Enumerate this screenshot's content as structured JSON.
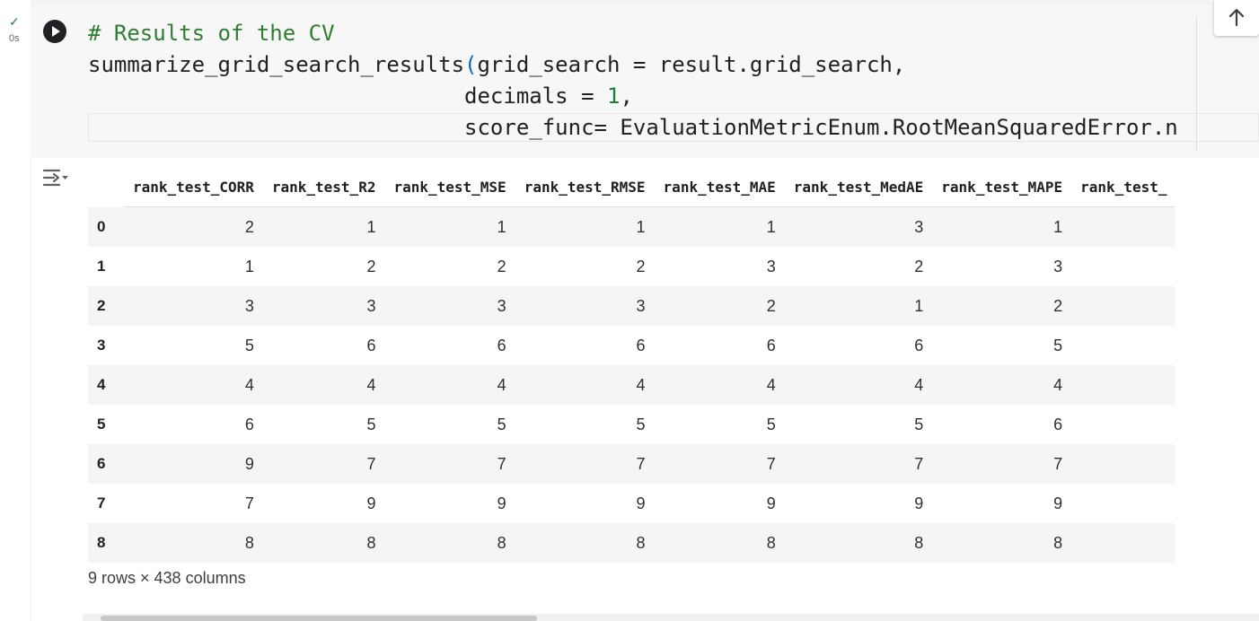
{
  "cell": {
    "status_check": "✓",
    "exec_time": "0s",
    "code": {
      "comment": "# Results of the CV",
      "line2_fn": "summarize_grid_search_results",
      "line2_paren": "(",
      "line2_rest": "grid_search = result.grid_search,",
      "line3_indent": "                             ",
      "line3_pre": "decimals = ",
      "line3_num": "1",
      "line3_post": ",",
      "line4_indent": "                             ",
      "line4": "score_func= EvaluationMetricEnum.RootMeanSquaredError.n"
    }
  },
  "output": {
    "columns": [
      "rank_test_CORR",
      "rank_test_R2",
      "rank_test_MSE",
      "rank_test_RMSE",
      "rank_test_MAE",
      "rank_test_MedAE",
      "rank_test_MAPE",
      "rank_test_"
    ],
    "rows": [
      {
        "index": "0",
        "values": [
          "2",
          "1",
          "1",
          "1",
          "1",
          "3",
          "1"
        ]
      },
      {
        "index": "1",
        "values": [
          "1",
          "2",
          "2",
          "2",
          "3",
          "2",
          "3"
        ]
      },
      {
        "index": "2",
        "values": [
          "3",
          "3",
          "3",
          "3",
          "2",
          "1",
          "2"
        ]
      },
      {
        "index": "3",
        "values": [
          "5",
          "6",
          "6",
          "6",
          "6",
          "6",
          "5"
        ]
      },
      {
        "index": "4",
        "values": [
          "4",
          "4",
          "4",
          "4",
          "4",
          "4",
          "4"
        ]
      },
      {
        "index": "5",
        "values": [
          "6",
          "5",
          "5",
          "5",
          "5",
          "5",
          "6"
        ]
      },
      {
        "index": "6",
        "values": [
          "9",
          "7",
          "7",
          "7",
          "7",
          "7",
          "7"
        ]
      },
      {
        "index": "7",
        "values": [
          "7",
          "9",
          "9",
          "9",
          "9",
          "9",
          "9"
        ]
      },
      {
        "index": "8",
        "values": [
          "8",
          "8",
          "8",
          "8",
          "8",
          "8",
          "8"
        ]
      }
    ],
    "summary": "9 rows × 438 columns"
  },
  "icons": {
    "run": "play-circle-icon",
    "up": "arrow-up-icon",
    "output_menu": "output-options-icon"
  },
  "colors": {
    "comment": "#2e7d32",
    "number": "#1a7f37",
    "paren": "#1565c0",
    "run_button": "#202124"
  }
}
